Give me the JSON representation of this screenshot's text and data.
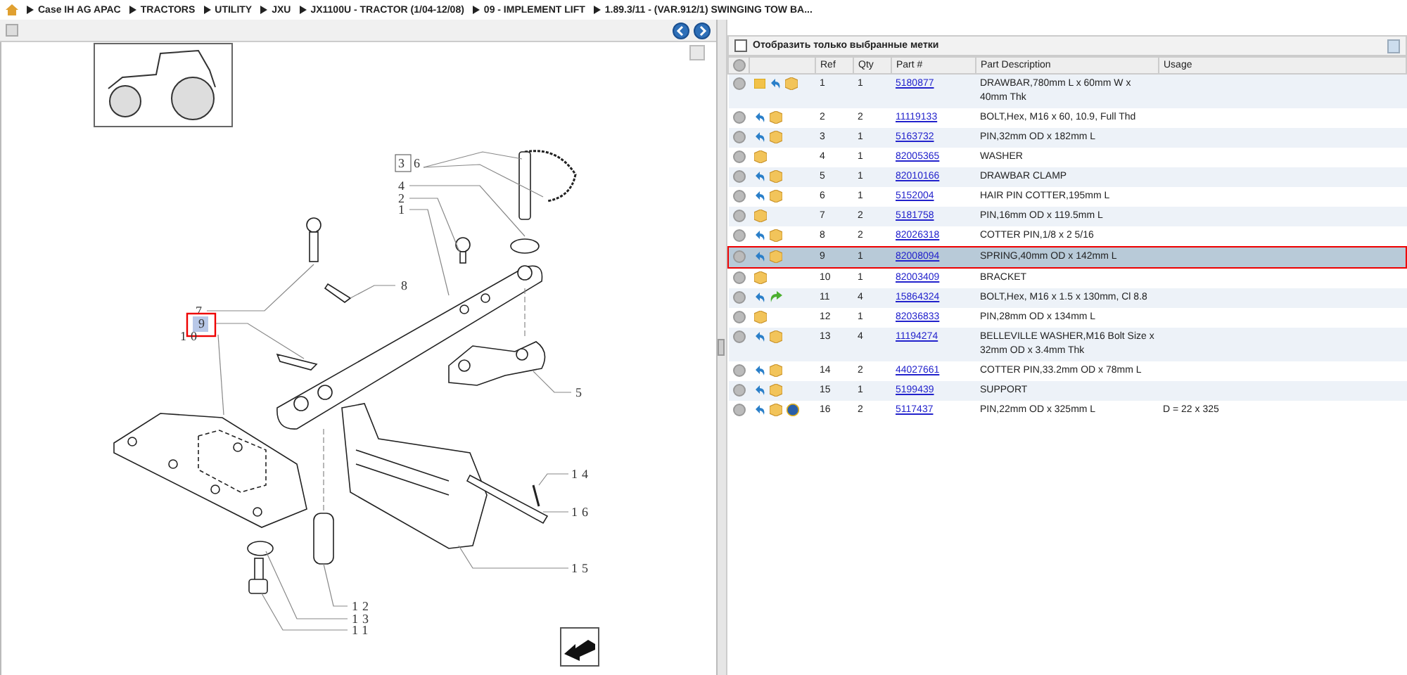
{
  "breadcrumb": [
    "Case IH AG APAC",
    "TRACTORS",
    "UTILITY",
    "JXU",
    "JX1100U - TRACTOR (1/04-12/08)",
    "09 - IMPLEMENT LIFT",
    "1.89.3/11 - (VAR.912/1) SWINGING TOW BA..."
  ],
  "diagram": {
    "callouts": [
      {
        "label": "3",
        "boxed": true,
        "selected": false
      },
      {
        "label": "6",
        "boxed": false,
        "selected": false
      },
      {
        "label": "4",
        "boxed": false,
        "selected": false
      },
      {
        "label": "2",
        "boxed": false,
        "selected": false
      },
      {
        "label": "1",
        "boxed": false,
        "selected": false
      },
      {
        "label": "8",
        "boxed": false,
        "selected": false
      },
      {
        "label": "7",
        "boxed": false,
        "selected": false
      },
      {
        "label": "9",
        "boxed": false,
        "selected": true
      },
      {
        "label": "10",
        "boxed": false,
        "selected": false
      },
      {
        "label": "5",
        "boxed": false,
        "selected": false
      },
      {
        "label": "14",
        "boxed": false,
        "selected": false
      },
      {
        "label": "16",
        "boxed": false,
        "selected": false
      },
      {
        "label": "15",
        "boxed": false,
        "selected": false
      },
      {
        "label": "12",
        "boxed": false,
        "selected": false
      },
      {
        "label": "13",
        "boxed": false,
        "selected": false
      },
      {
        "label": "11",
        "boxed": false,
        "selected": false
      }
    ]
  },
  "filter": {
    "label": "Отобразить только выбранные метки",
    "checked": false
  },
  "table": {
    "columns": [
      "Ref",
      "Qty",
      "Part #",
      "Part Description",
      "Usage"
    ],
    "rows": [
      {
        "icons": [
          {
            "kind": "note"
          },
          {
            "kind": "arrow"
          },
          {
            "kind": "box"
          }
        ],
        "ref": "1",
        "qty": "1",
        "part": "5180877",
        "description": "DRAWBAR,780mm L x 60mm W x 40mm Thk",
        "usage": "",
        "selected": false
      },
      {
        "icons": [
          {
            "kind": "arrow"
          },
          {
            "kind": "box"
          }
        ],
        "ref": "2",
        "qty": "2",
        "part": "11119133",
        "description": "BOLT,Hex, M16 x 60, 10.9, Full Thd",
        "usage": "",
        "selected": false
      },
      {
        "icons": [
          {
            "kind": "arrow"
          },
          {
            "kind": "box"
          }
        ],
        "ref": "3",
        "qty": "1",
        "part": "5163732",
        "description": "PIN,32mm OD x 182mm L",
        "usage": "",
        "selected": false
      },
      {
        "icons": [
          {
            "kind": "box"
          }
        ],
        "ref": "4",
        "qty": "1",
        "part": "82005365",
        "description": "WASHER",
        "usage": "",
        "selected": false
      },
      {
        "icons": [
          {
            "kind": "arrow"
          },
          {
            "kind": "box"
          }
        ],
        "ref": "5",
        "qty": "1",
        "part": "82010166",
        "description": "DRAWBAR CLAMP",
        "usage": "",
        "selected": false
      },
      {
        "icons": [
          {
            "kind": "arrow"
          },
          {
            "kind": "box"
          }
        ],
        "ref": "6",
        "qty": "1",
        "part": "5152004",
        "description": "HAIR PIN COTTER,195mm L",
        "usage": "",
        "selected": false
      },
      {
        "icons": [
          {
            "kind": "box"
          }
        ],
        "ref": "7",
        "qty": "2",
        "part": "5181758",
        "description": "PIN,16mm OD x 119.5mm L",
        "usage": "",
        "selected": false
      },
      {
        "icons": [
          {
            "kind": "arrow"
          },
          {
            "kind": "box"
          }
        ],
        "ref": "8",
        "qty": "2",
        "part": "82026318",
        "description": "COTTER PIN,1/8 x 2 5/16",
        "usage": "",
        "selected": false
      },
      {
        "icons": [
          {
            "kind": "arrow"
          },
          {
            "kind": "box"
          }
        ],
        "ref": "9",
        "qty": "1",
        "part": "82008094",
        "description": "SPRING,40mm OD x 142mm L",
        "usage": "",
        "selected": true
      },
      {
        "icons": [
          {
            "kind": "box"
          }
        ],
        "ref": "10",
        "qty": "1",
        "part": "82003409",
        "description": "BRACKET",
        "usage": "",
        "selected": false
      },
      {
        "icons": [
          {
            "kind": "arrow"
          },
          {
            "kind": "green-arrow"
          }
        ],
        "ref": "11",
        "qty": "4",
        "part": "15864324",
        "description": "BOLT,Hex, M16 x 1.5 x 130mm, Cl 8.8",
        "usage": "",
        "selected": false
      },
      {
        "icons": [
          {
            "kind": "box"
          }
        ],
        "ref": "12",
        "qty": "1",
        "part": "82036833",
        "description": "PIN,28mm OD x 134mm L",
        "usage": "",
        "selected": false
      },
      {
        "icons": [
          {
            "kind": "arrow"
          },
          {
            "kind": "box"
          }
        ],
        "ref": "13",
        "qty": "4",
        "part": "11194274",
        "description": "BELLEVILLE WASHER,M16 Bolt Size x 32mm OD x 3.4mm Thk",
        "usage": "",
        "selected": false
      },
      {
        "icons": [
          {
            "kind": "arrow"
          },
          {
            "kind": "box"
          }
        ],
        "ref": "14",
        "qty": "2",
        "part": "44027661",
        "description": "COTTER PIN,33.2mm OD x 78mm L",
        "usage": "",
        "selected": false
      },
      {
        "icons": [
          {
            "kind": "arrow"
          },
          {
            "kind": "box"
          }
        ],
        "ref": "15",
        "qty": "1",
        "part": "5199439",
        "description": "SUPPORT",
        "usage": "",
        "selected": false
      },
      {
        "icons": [
          {
            "kind": "arrow"
          },
          {
            "kind": "box"
          },
          {
            "kind": "globe"
          }
        ],
        "ref": "16",
        "qty": "2",
        "part": "5117437",
        "description": "PIN,22mm OD x 325mm L",
        "usage": "D = 22 x 325",
        "selected": false
      }
    ]
  }
}
